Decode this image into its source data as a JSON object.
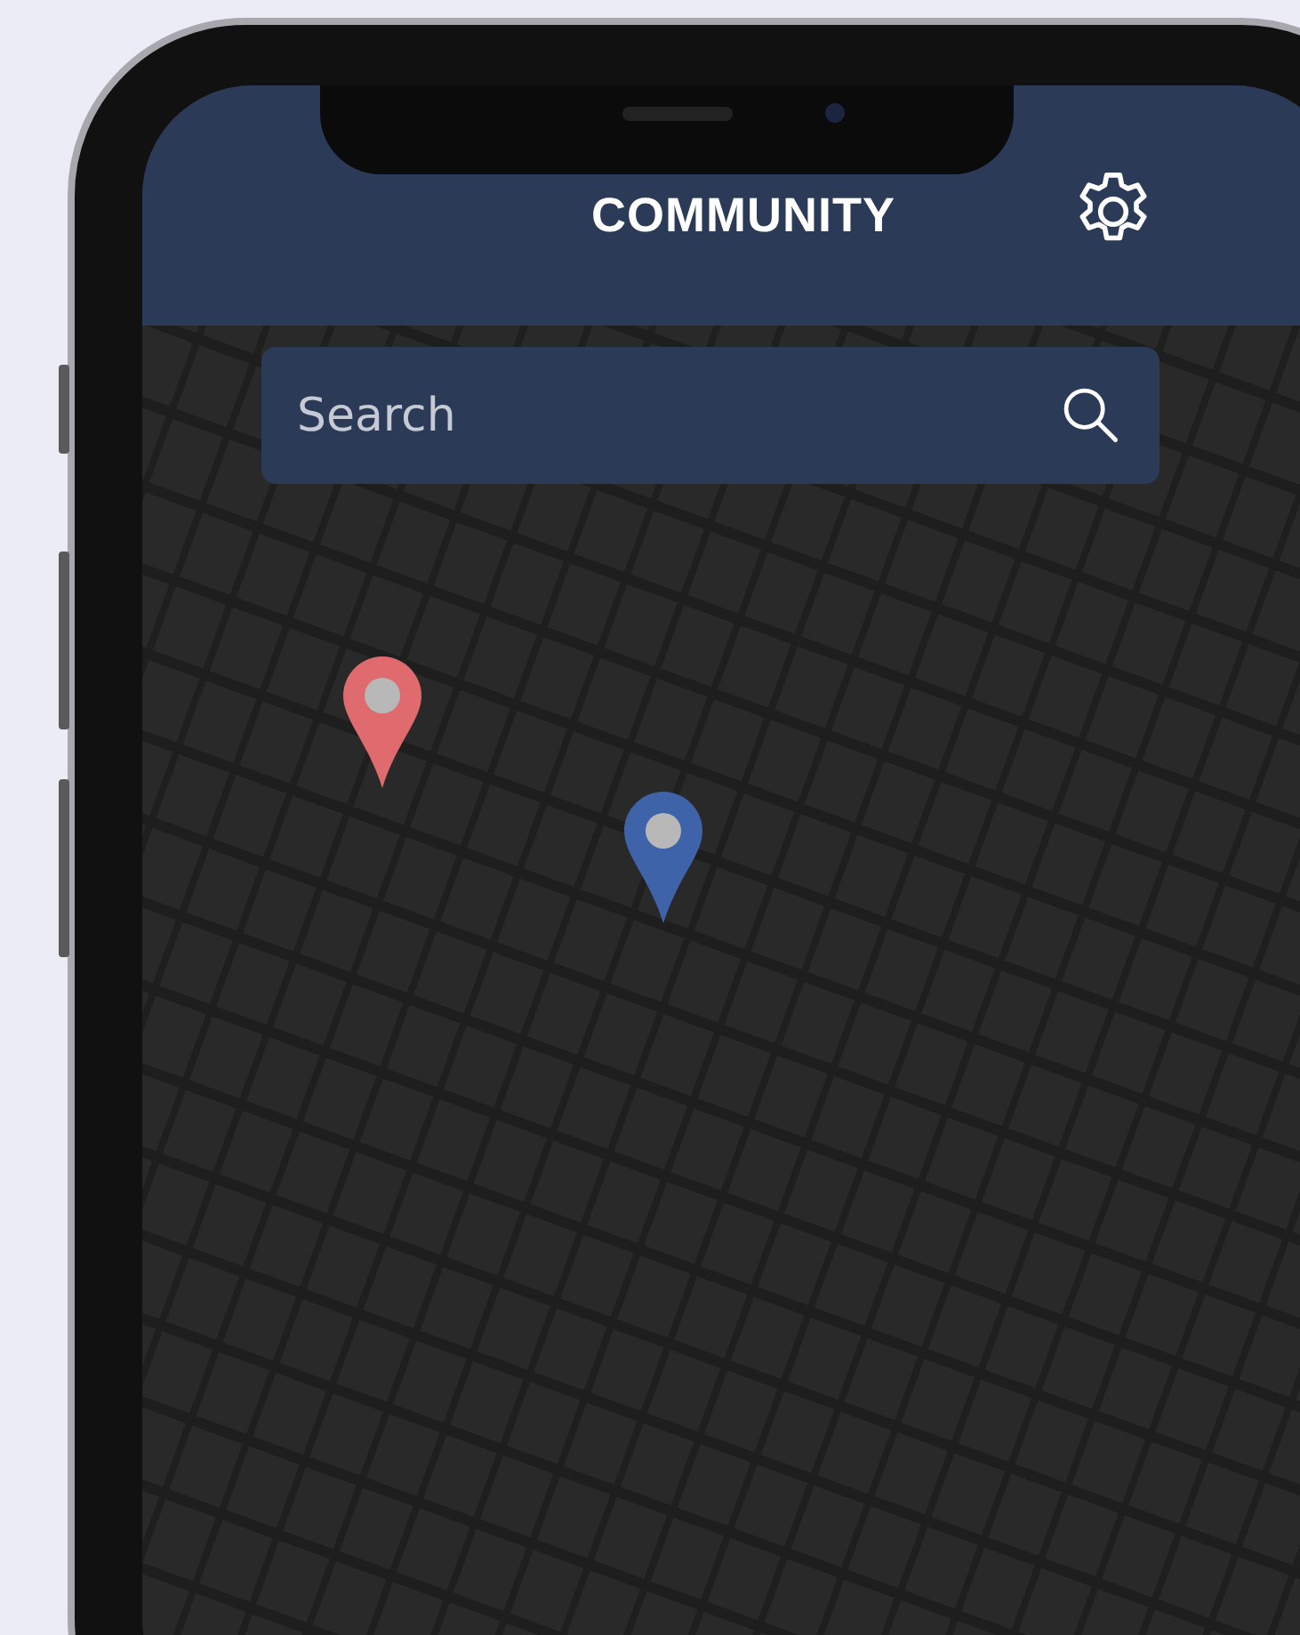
{
  "header": {
    "title": "COMMUNITY"
  },
  "search": {
    "placeholder": "Search"
  },
  "map": {
    "pins": [
      {
        "color": "#e06b6f"
      },
      {
        "color": "#3f63a8"
      }
    ]
  }
}
